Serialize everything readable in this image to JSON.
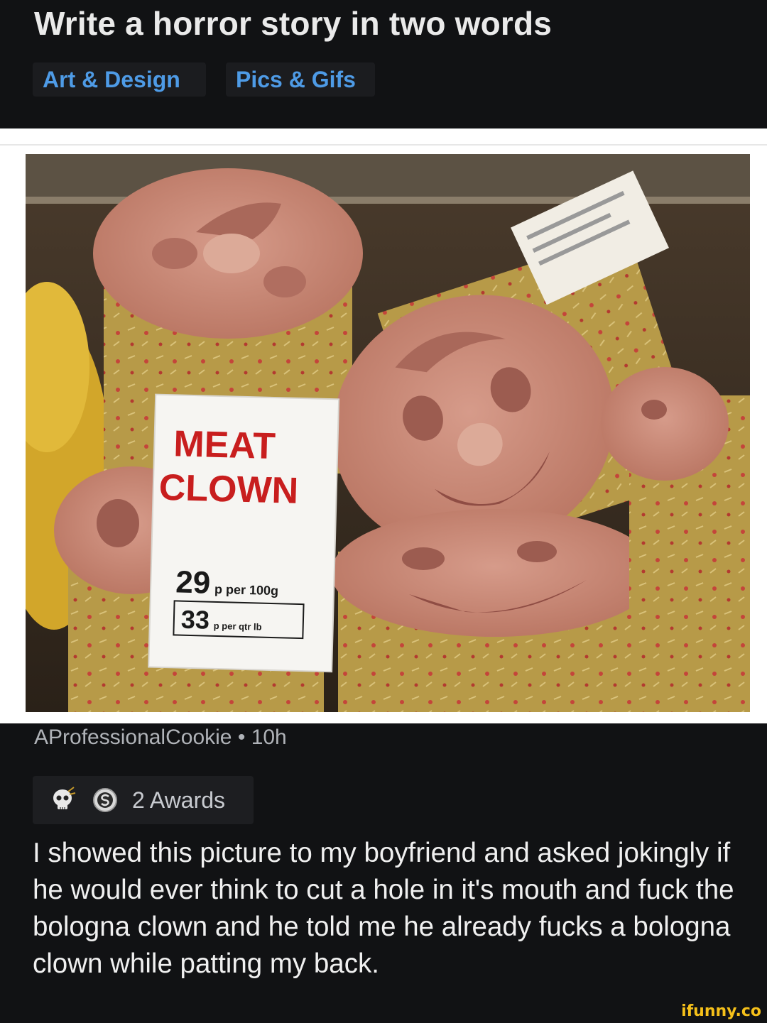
{
  "post": {
    "title": "Write a horror story in two words",
    "flairs": [
      "Art & Design",
      "Pics & Gifs"
    ]
  },
  "image": {
    "sign": {
      "line1": "MEAT",
      "line2": "CLOWN",
      "price_main": "29",
      "price_main_unit": "p per 100g",
      "price_sub": "33",
      "price_sub_unit": "p per qtr lb"
    }
  },
  "comment": {
    "author": "AProfessionalCookie",
    "separator": "•",
    "age": "10h",
    "awards_label": "2 Awards",
    "body": "I showed this picture to my boyfriend and asked jokingly if he would ever think to cut a hole in it's mouth and fuck the bologna clown and he told me he already fucks a bologna clown while patting my back."
  },
  "watermark": "ifunny.co",
  "icons": [
    "skull-award-icon",
    "silver-award-icon"
  ]
}
